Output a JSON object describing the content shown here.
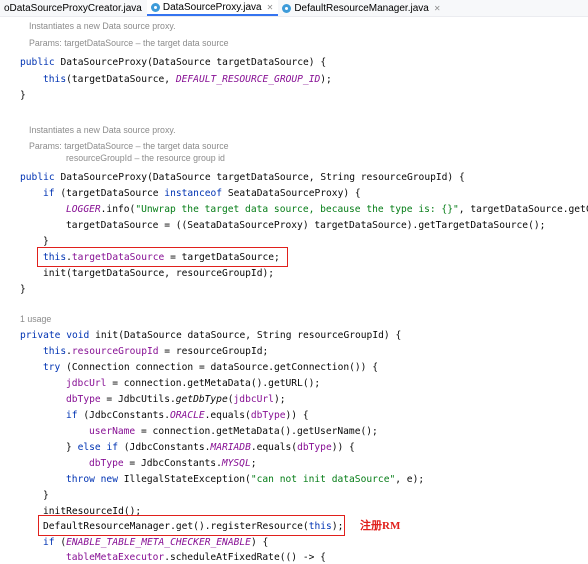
{
  "tabs": [
    {
      "label": "oDataSourceProxyCreator.java",
      "active": false,
      "closable": false
    },
    {
      "label": "DataSourceProxy.java",
      "active": true,
      "closable": true
    },
    {
      "label": "DefaultResourceManager.java",
      "active": false,
      "closable": true
    }
  ],
  "doc1": {
    "text": "Instantiates a new Data source proxy.",
    "params_label": "Params:",
    "param1_name": "targetDataSource",
    "param1_desc": " – the target data source"
  },
  "ctor1": {
    "l1_kw": "public ",
    "l1_rest": "DataSourceProxy(DataSource targetDataSource) {",
    "l2_kw": "this",
    "l2_mid": "(targetDataSource, ",
    "l2_const": "DEFAULT_RESOURCE_GROUP_ID",
    "l2_end": ");",
    "l3": "}"
  },
  "doc2": {
    "text": "Instantiates a new Data source proxy.",
    "params_label": "Params:",
    "param1_name": "targetDataSource",
    "param1_desc": " – the target data source",
    "param2_name": "resourceGroupId",
    "param2_desc": " – the resource group id"
  },
  "ctor2": {
    "l1_kw": "public ",
    "l1_rest": "DataSourceProxy(DataSource targetDataSource, String resourceGroupId) {",
    "l2_kw1": "if ",
    "l2_mid": "(targetDataSource ",
    "l2_kw2": "instanceof ",
    "l2_end": "SeataDataSourceProxy) {",
    "l3_logger": "LOGGER",
    "l3_mid": ".info(",
    "l3_str": "\"Unwrap the target data source, because the type is: {}\"",
    "l3_end": ", targetDataSource.getCl",
    "l4": "targetDataSource = ((SeataDataSourceProxy) targetDataSource).getTargetDataSource();",
    "l5": "}",
    "l6_kw": "this",
    "l6_dot": ".",
    "l6_fld": "targetDataSource",
    "l6_end": " = targetDataSource;",
    "l7": "init(targetDataSource, resourceGroupId);",
    "l8": "}"
  },
  "usage": "1 usage",
  "init": {
    "l1_kw": "private void ",
    "l1_rest": "init(DataSource dataSource, String resourceGroupId) {",
    "l2_kw": "this",
    "l2_dot": ".",
    "l2_fld": "resourceGroupId",
    "l2_end": " = resourceGroupId;",
    "l3_kw": "try ",
    "l3_end": "(Connection connection = dataSource.getConnection()) {",
    "l4_fld": "jdbcUrl",
    "l4_end": " = connection.getMetaData().getURL();",
    "l5_fld": "dbType",
    "l5_mid": " = JdbcUtils.",
    "l5_static": "getDbType",
    "l5_p": "(",
    "l5_arg": "jdbcUrl",
    "l5_end": ");",
    "l6_kw": "if ",
    "l6_mid": "(JdbcConstants.",
    "l6_const": "ORACLE",
    "l6_eq": ".equals(",
    "l6_arg": "dbType",
    "l6_end": ")) {",
    "l7_fld": "userName",
    "l7_end": " = connection.getMetaData().getUserName();",
    "l8_a": "} ",
    "l8_kw": "else if ",
    "l8_mid": "(JdbcConstants.",
    "l8_const": "MARIADB",
    "l8_eq": ".equals(",
    "l8_arg": "dbType",
    "l8_end": ")) {",
    "l9_fld": "dbType",
    "l9_mid": " = JdbcConstants.",
    "l9_const": "MYSQL",
    "l9_end": ";",
    "l10_kw1": "throw new ",
    "l10_mid": "IllegalStateException(",
    "l10_str": "\"can not init dataSource\"",
    "l10_end": ", e);",
    "l11": "}",
    "l12": "initResourceId();",
    "l13_a": "DefaultResourceManager.get().registerResource(",
    "l13_kw": "this",
    "l13_end": ");",
    "l14_kw": "if ",
    "l14_p": "(",
    "l14_const": "ENABLE_TABLE_META_CHECKER_ENABLE",
    "l14_end": ") {",
    "l15_fld": "tableMetaExecutor",
    "l15_end": ".scheduleAtFixedRate(() -> {"
  },
  "annotation": {
    "text": "注册RM",
    "color": "#e0201c"
  }
}
